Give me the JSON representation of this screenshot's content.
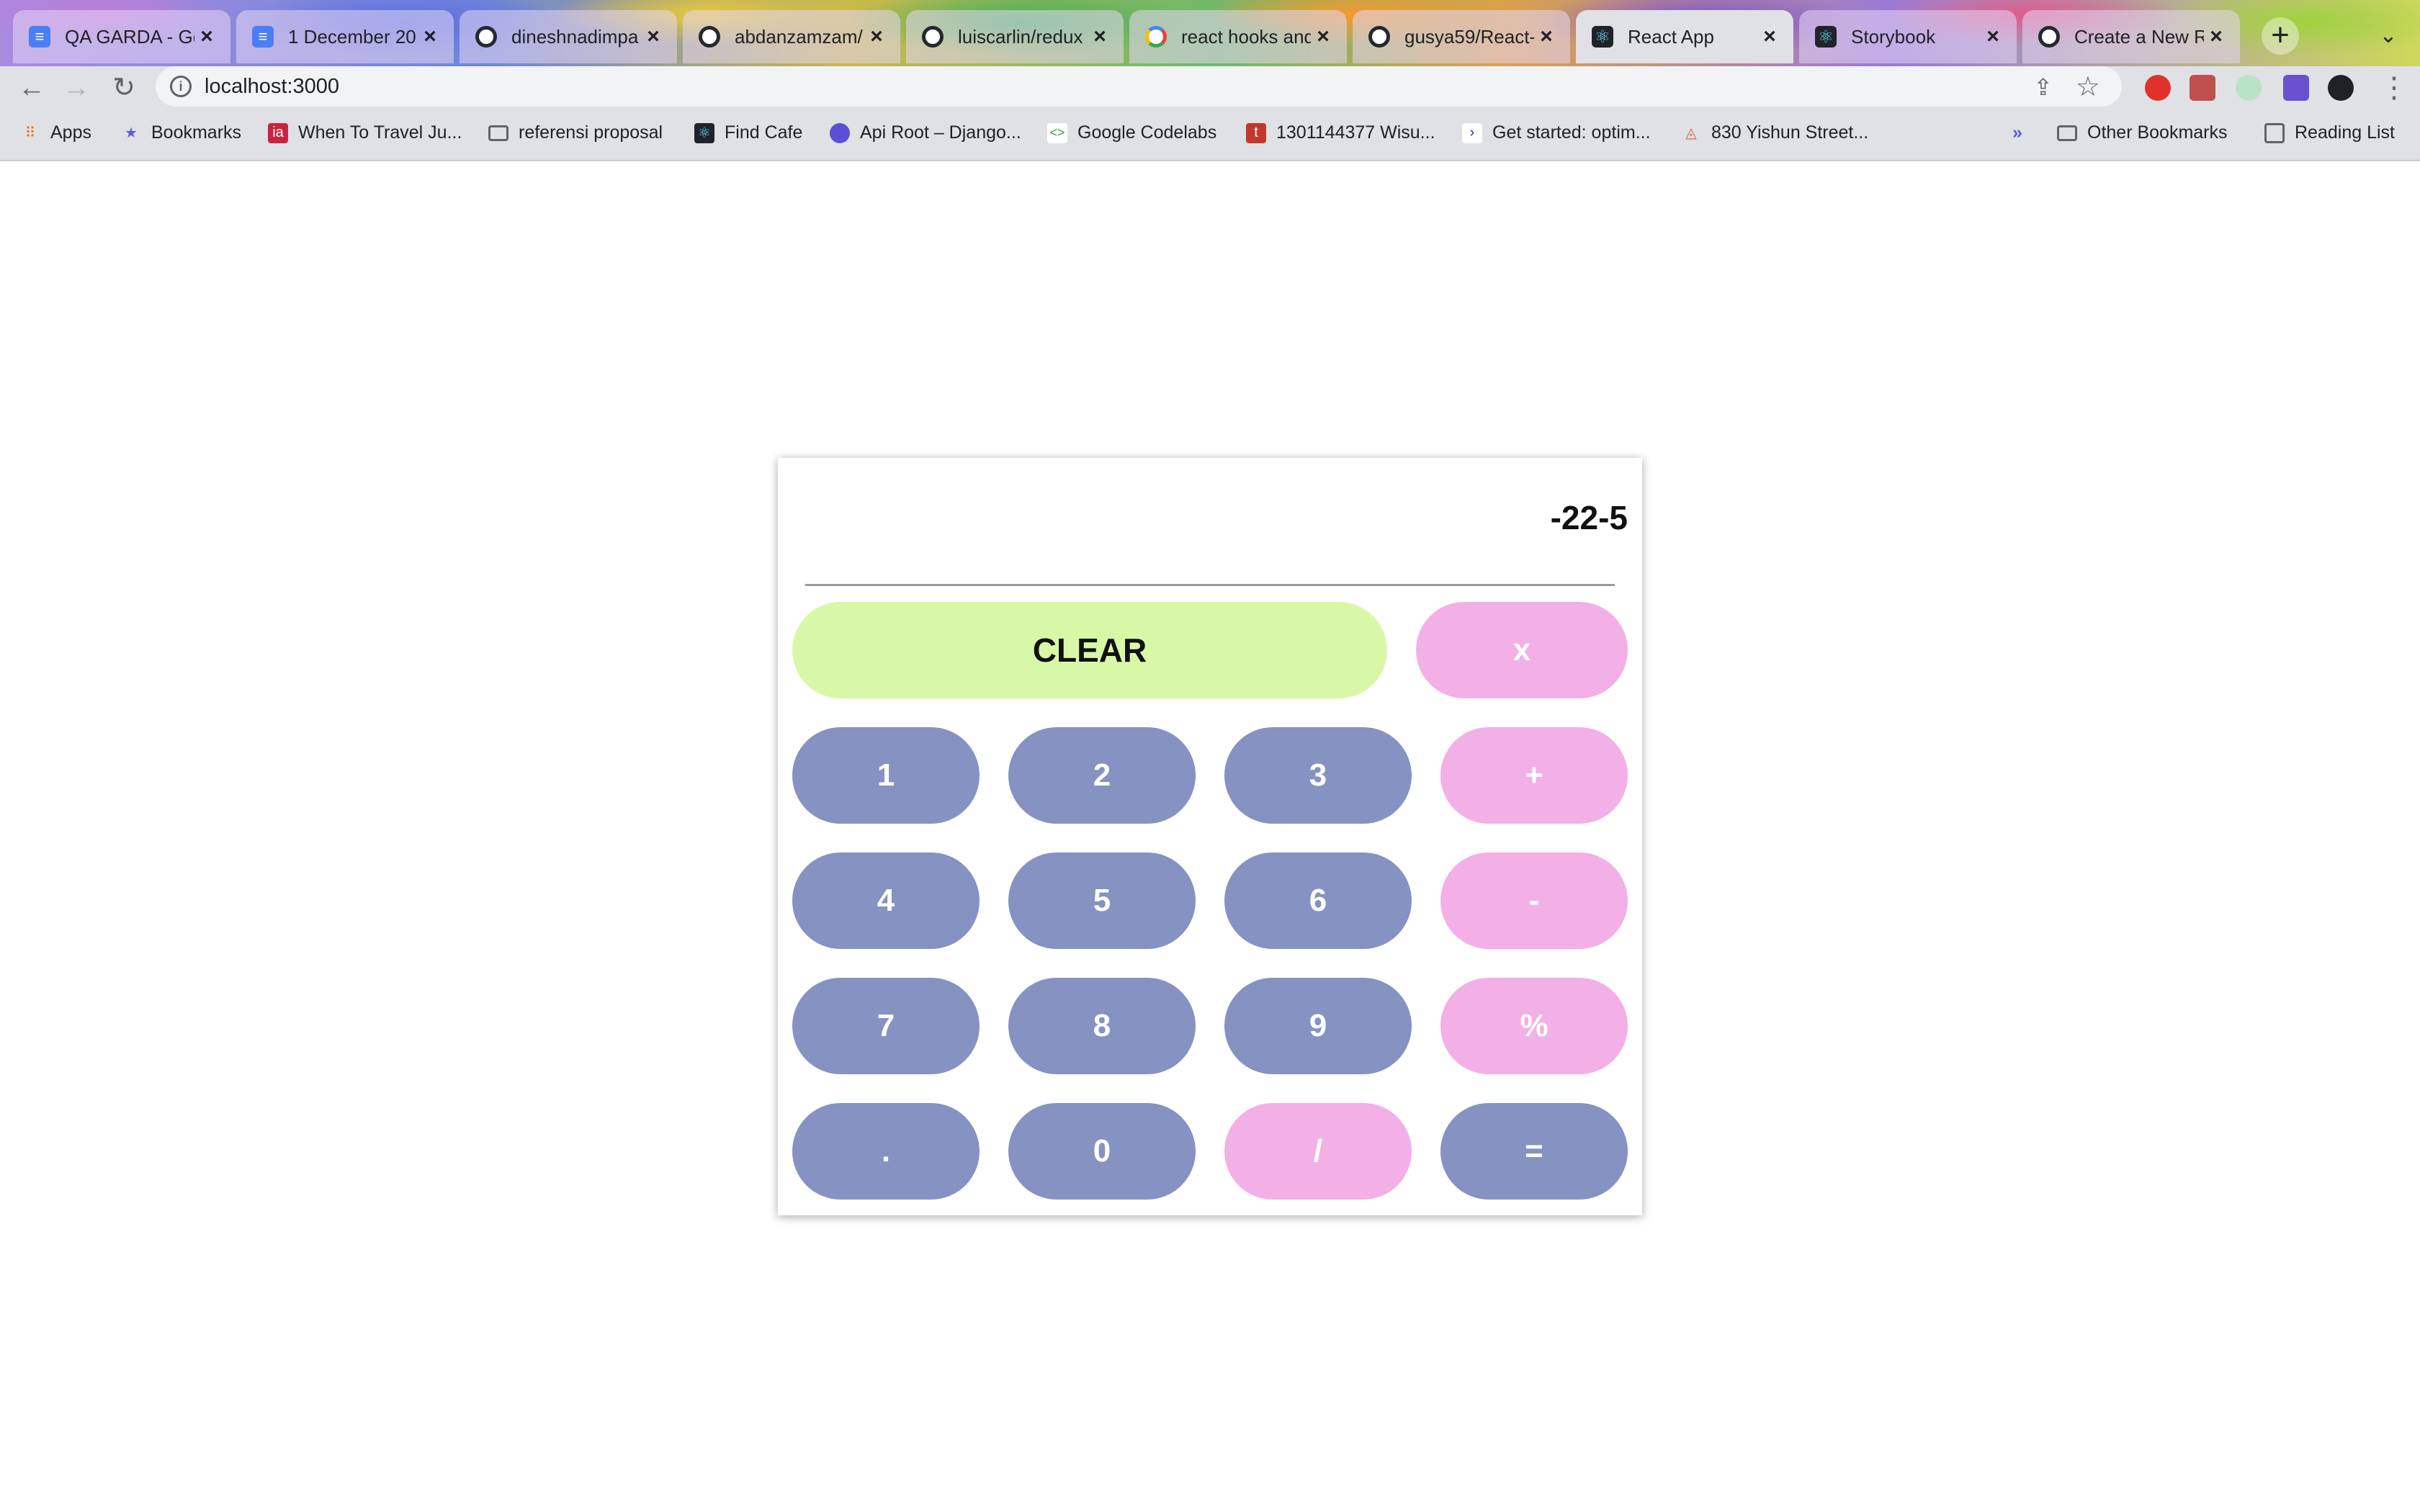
{
  "browser": {
    "tabs": [
      {
        "title": "QA GARDA - Go",
        "favicon": "docs-icon"
      },
      {
        "title": "1 December 20",
        "favicon": "docs-icon"
      },
      {
        "title": "dineshnadimpa",
        "favicon": "github-icon"
      },
      {
        "title": "abdanzamzam/",
        "favicon": "github-icon"
      },
      {
        "title": "luiscarlin/redux",
        "favicon": "github-icon"
      },
      {
        "title": "react hooks and",
        "favicon": "google-icon"
      },
      {
        "title": "gusya59/React-",
        "favicon": "github-icon"
      },
      {
        "title": "React App",
        "favicon": "react-icon"
      },
      {
        "title": "Storybook",
        "favicon": "react-icon"
      },
      {
        "title": "Create a New R",
        "favicon": "github-icon"
      }
    ],
    "active_tab": 7,
    "url": "localhost:3000",
    "bookmarks": [
      {
        "label": "Apps",
        "icon": "apps-grid-icon"
      },
      {
        "label": "Bookmarks",
        "icon": "star-icon"
      },
      {
        "label": "When To Travel Ju...",
        "icon": "site-icon"
      },
      {
        "label": "referensi proposal",
        "icon": "folder-icon"
      },
      {
        "label": "Find Cafe",
        "icon": "react-icon"
      },
      {
        "label": "Api Root – Django...",
        "icon": "site-icon"
      },
      {
        "label": "Google Codelabs",
        "icon": "codelabs-icon"
      },
      {
        "label": "1301144377 Wisu...",
        "icon": "site-icon"
      },
      {
        "label": "Get started: optim...",
        "icon": "site-icon"
      },
      {
        "label": "830 Yishun Street...",
        "icon": "site-icon"
      }
    ],
    "bookmarks_overflow": "»",
    "other_bookmarks": "Other Bookmarks",
    "reading_list": "Reading List"
  },
  "calculator": {
    "display_value": "-22-5",
    "clear_label": "CLEAR",
    "keys": {
      "multiply": "x",
      "one": "1",
      "two": "2",
      "three": "3",
      "plus": "+",
      "four": "4",
      "five": "5",
      "six": "6",
      "minus": "-",
      "seven": "7",
      "eight": "8",
      "nine": "9",
      "percent": "%",
      "decimal": ".",
      "zero": "0",
      "divide": "/",
      "equals": "="
    },
    "colors": {
      "number_key": "#8592c2",
      "operator_key": "#f2b0e6",
      "clear_key": "#d8f8a8"
    }
  }
}
